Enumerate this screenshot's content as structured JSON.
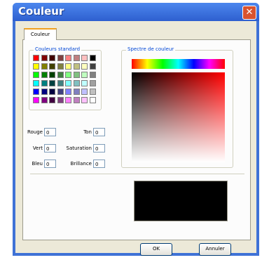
{
  "window": {
    "title": "Couleur",
    "close_icon": "close-icon"
  },
  "tabs": [
    {
      "label": "Couleur"
    }
  ],
  "standard_colors": {
    "label": "Couleurs standard",
    "swatches": [
      [
        "#ff0000",
        "#800000",
        "#400000",
        "#804040",
        "#ff8080",
        "#c08080",
        "#ffc0c0",
        "#000000"
      ],
      [
        "#ffff00",
        "#808000",
        "#404000",
        "#808040",
        "#ffff80",
        "#c0c080",
        "#ffffc0",
        "#404040"
      ],
      [
        "#00ff00",
        "#008000",
        "#004000",
        "#408040",
        "#80ff80",
        "#80c080",
        "#c0ffc0",
        "#808080"
      ],
      [
        "#00ffff",
        "#008080",
        "#004040",
        "#408080",
        "#80ffff",
        "#80c0c0",
        "#c0ffff",
        "#a0a0a0"
      ],
      [
        "#0000ff",
        "#000080",
        "#000040",
        "#404080",
        "#8080ff",
        "#8080c0",
        "#c0c0ff",
        "#c0c0c0"
      ],
      [
        "#ff00ff",
        "#800080",
        "#400040",
        "#804080",
        "#ff80ff",
        "#c080c0",
        "#ffc0ff",
        "#ffffff"
      ]
    ]
  },
  "spectrum": {
    "label": "Spectre de couleur"
  },
  "fields": {
    "rouge": {
      "label": "Rouge",
      "value": "0"
    },
    "vert": {
      "label": "Vert",
      "value": "0"
    },
    "bleu": {
      "label": "Bleu",
      "value": "0"
    },
    "ton": {
      "label": "Ton",
      "value": "0"
    },
    "saturation": {
      "label": "Saturation",
      "value": "0"
    },
    "brillance": {
      "label": "Brillance",
      "value": "0"
    }
  },
  "preview": {
    "color": "#000000"
  },
  "buttons": {
    "ok": "OK",
    "cancel": "Annuler"
  }
}
